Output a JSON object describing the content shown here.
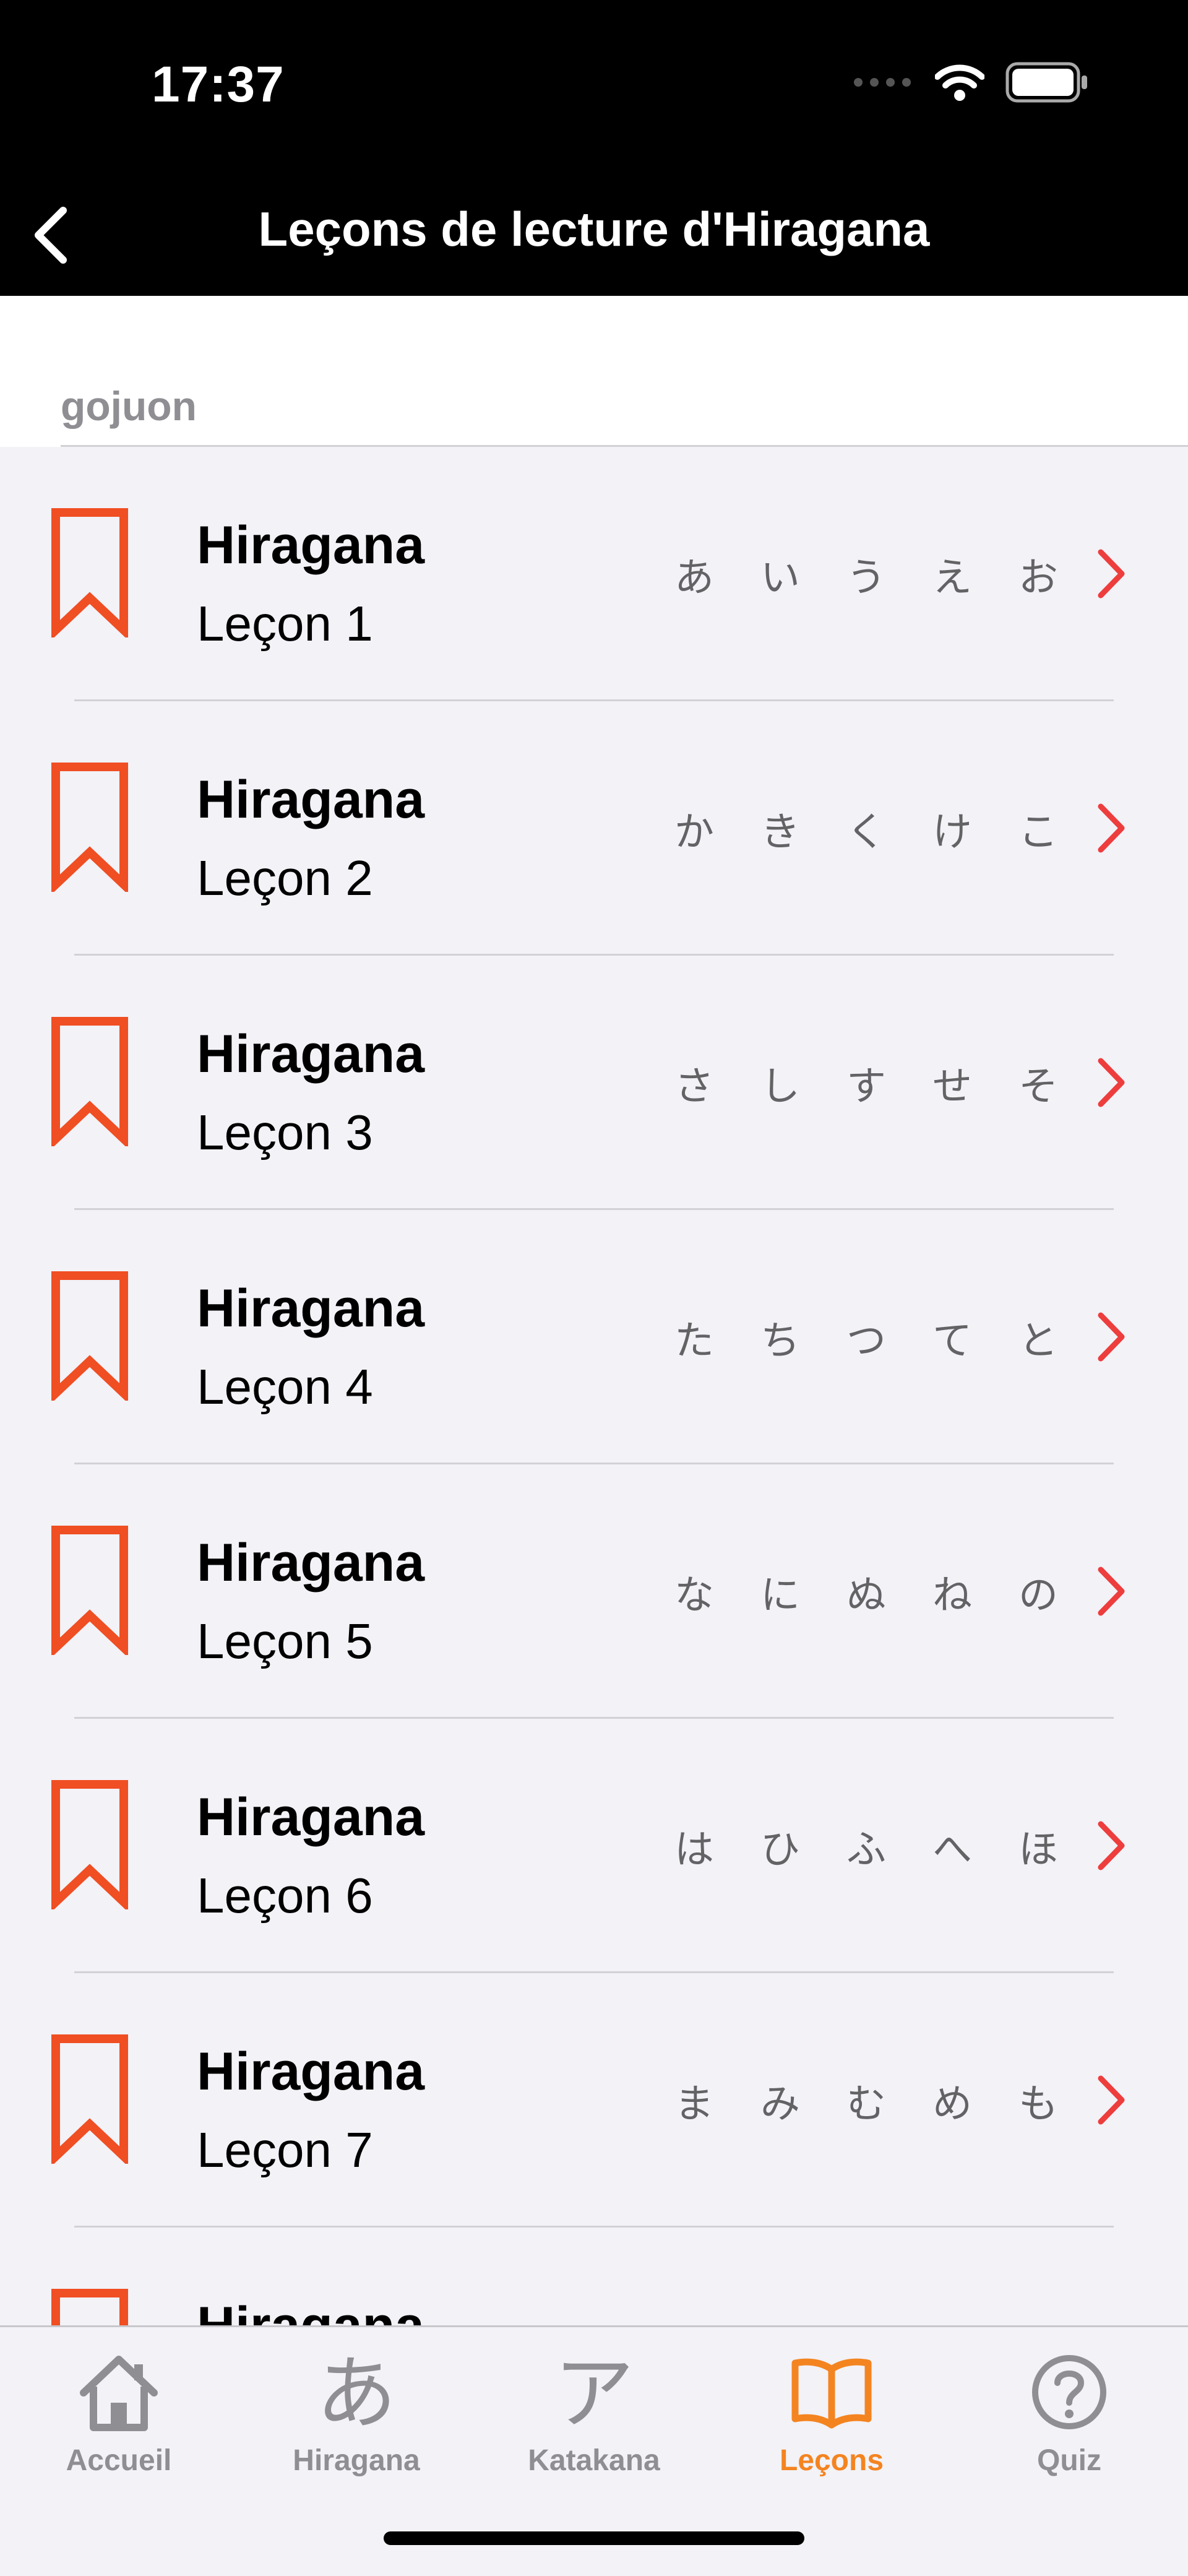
{
  "status_bar": {
    "time": "17:37"
  },
  "nav": {
    "title": "Leçons de lecture d'Hiragana"
  },
  "section": {
    "label": "gojuon"
  },
  "colors": {
    "accent": "#f04e23",
    "tab_active": "#f48420",
    "chevron": "#ee3d3d"
  },
  "lessons": [
    {
      "title": "Hiragana",
      "subtitle": "Leçon 1",
      "kana": [
        "あ",
        "い",
        "う",
        "え",
        "お"
      ]
    },
    {
      "title": "Hiragana",
      "subtitle": "Leçon 2",
      "kana": [
        "か",
        "き",
        "く",
        "け",
        "こ"
      ]
    },
    {
      "title": "Hiragana",
      "subtitle": "Leçon 3",
      "kana": [
        "さ",
        "し",
        "す",
        "せ",
        "そ"
      ]
    },
    {
      "title": "Hiragana",
      "subtitle": "Leçon 4",
      "kana": [
        "た",
        "ち",
        "つ",
        "て",
        "と"
      ]
    },
    {
      "title": "Hiragana",
      "subtitle": "Leçon 5",
      "kana": [
        "な",
        "に",
        "ぬ",
        "ね",
        "の"
      ]
    },
    {
      "title": "Hiragana",
      "subtitle": "Leçon 6",
      "kana": [
        "は",
        "ひ",
        "ふ",
        "へ",
        "ほ"
      ]
    },
    {
      "title": "Hiragana",
      "subtitle": "Leçon 7",
      "kana": [
        "ま",
        "み",
        "む",
        "め",
        "も"
      ]
    },
    {
      "title": "Hiragana",
      "subtitle": "",
      "kana": []
    }
  ],
  "tabs": [
    {
      "label": "Accueil",
      "icon": "home-icon"
    },
    {
      "label": "Hiragana",
      "icon": "hiragana-a-icon",
      "glyph": "あ"
    },
    {
      "label": "Katakana",
      "icon": "katakana-a-icon",
      "glyph": "ア"
    },
    {
      "label": "Leçons",
      "icon": "book-icon",
      "active": true
    },
    {
      "label": "Quiz",
      "icon": "question-circle-icon"
    }
  ]
}
